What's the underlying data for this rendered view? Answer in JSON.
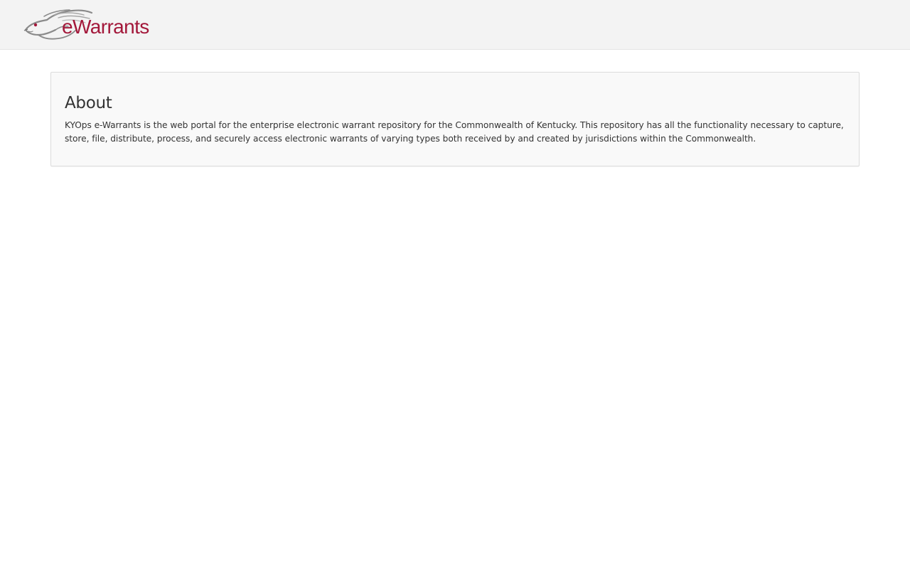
{
  "header": {
    "logo_text": "eWarrants",
    "logo_icon": "horse-head-icon",
    "brand_color": "#a3183a",
    "background_color": "#f3f3f3"
  },
  "about": {
    "title": "About",
    "description": "KYOps e-Warrants is the web portal for the enterprise electronic warrant repository for the Commonwealth of Kentucky. This repository has all the functionality necessary to capture, store, file, distribute, process, and securely access electronic warrants of varying types both received by and created by jurisdictions within the Commonwealth."
  }
}
